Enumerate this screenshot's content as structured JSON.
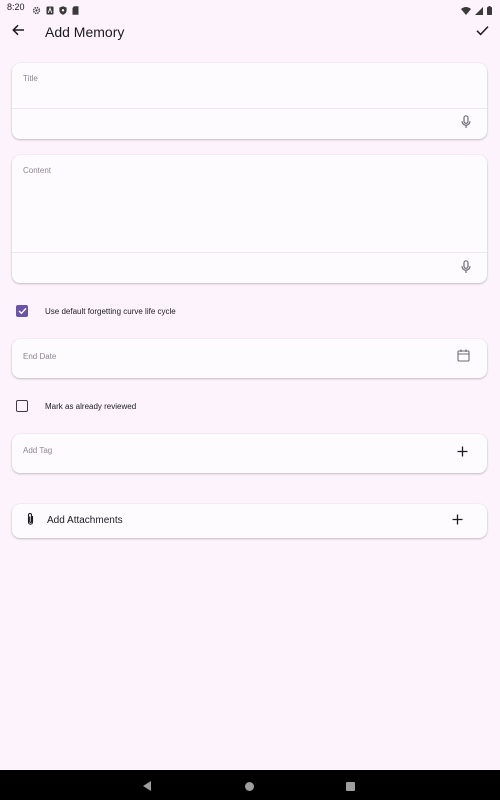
{
  "status_bar": {
    "time": "8:20",
    "icons": [
      "gear-icon",
      "notification-a-icon",
      "shield-icon",
      "sd-card-icon",
      "wifi-icon",
      "signal-icon",
      "battery-icon"
    ]
  },
  "app_bar": {
    "title": "Add Memory",
    "back_icon": "arrow-left-icon",
    "done_icon": "check-icon"
  },
  "form": {
    "title_field": {
      "label": "Title",
      "value": "",
      "mic_icon": "mic-icon"
    },
    "content_field": {
      "label": "Content",
      "value": "",
      "mic_icon": "mic-icon"
    },
    "forgetting_curve": {
      "label": "Use default forgetting curve life cycle",
      "checked": true
    },
    "end_date": {
      "label": "End Date",
      "icon": "calendar-icon"
    },
    "reviewed": {
      "label": "Mark as already reviewed",
      "checked": false
    },
    "tag": {
      "label": "Add Tag",
      "icon": "plus-icon"
    },
    "attachments": {
      "label": "Add Attachments",
      "icon": "paperclip-icon",
      "add_icon": "plus-icon"
    }
  },
  "nav_bar": {
    "icons": [
      "back-triangle-icon",
      "home-circle-icon",
      "recents-square-icon"
    ]
  },
  "colors": {
    "background": "#fcf3fd",
    "card": "#fefbff",
    "accent": "#6b53a7",
    "label": "#8b868f"
  }
}
